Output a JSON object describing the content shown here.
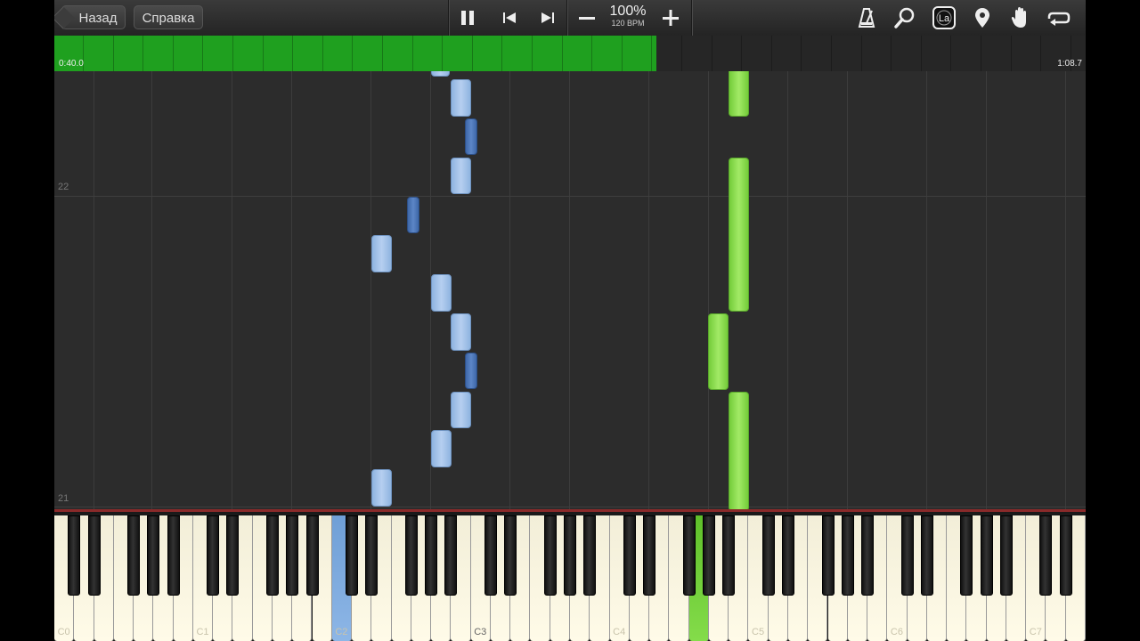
{
  "toolbar": {
    "back_label": "Назад",
    "help_label": "Справка",
    "speed_percent": "100%",
    "tempo": "120 BPM",
    "icons": [
      "pause-icon",
      "previous-icon",
      "next-icon",
      "minus-icon",
      "plus-icon",
      "metronome-icon",
      "search-icon",
      "note-labels-icon",
      "location-pin-icon",
      "hand-icon",
      "loop-icon"
    ],
    "note_labels_icon_text": "La"
  },
  "progress": {
    "current_time": "0:40.0",
    "total_time": "1:08.7",
    "played_fraction": 0.584,
    "colors": {
      "played": "#1fa01f",
      "remaining": "#262626"
    }
  },
  "roll": {
    "measures": [
      "22",
      "21"
    ]
  },
  "keyboard": {
    "octave_labels": [
      "C0",
      "C1",
      "C2",
      "C3",
      "C4",
      "C5",
      "C6",
      "C7"
    ],
    "pressed_keys": [
      {
        "key": "C2",
        "color": "#7aa7dc",
        "hand": "left"
      },
      {
        "key": "G4",
        "color": "#6fd03a",
        "hand": "right"
      }
    ]
  },
  "colors": {
    "left_hand_light": "#a9c6ec",
    "left_hand_dark": "#4a72b2",
    "right_hand": "#8ee24e",
    "keyboard_border": "#8a2a2a"
  }
}
